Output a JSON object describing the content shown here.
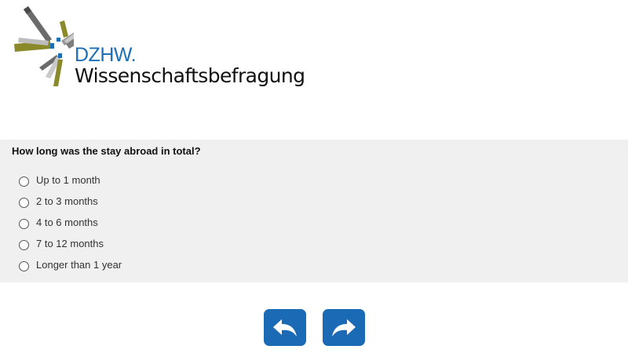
{
  "header": {
    "logo": {
      "abbreviation": "DZHW.",
      "name": "Wissenschaftsbefragung"
    }
  },
  "question": {
    "text": "How long was the stay abroad in total?",
    "options": [
      {
        "label": "Up to 1 month",
        "selected": false
      },
      {
        "label": "2 to 3 months",
        "selected": false
      },
      {
        "label": "4 to 6 months",
        "selected": false
      },
      {
        "label": "7 to 12 months",
        "selected": false
      },
      {
        "label": "Longer than 1 year",
        "selected": false
      }
    ]
  },
  "navigation": {
    "back_icon": "undo-arrow-icon",
    "next_icon": "redo-arrow-icon"
  },
  "colors": {
    "accent": "#1a6ab5",
    "brand_blue": "#1c6fb6",
    "brand_olive": "#8a8a2a",
    "brand_gray": "#6b6b6b",
    "panel_background": "#f0f0f0"
  }
}
